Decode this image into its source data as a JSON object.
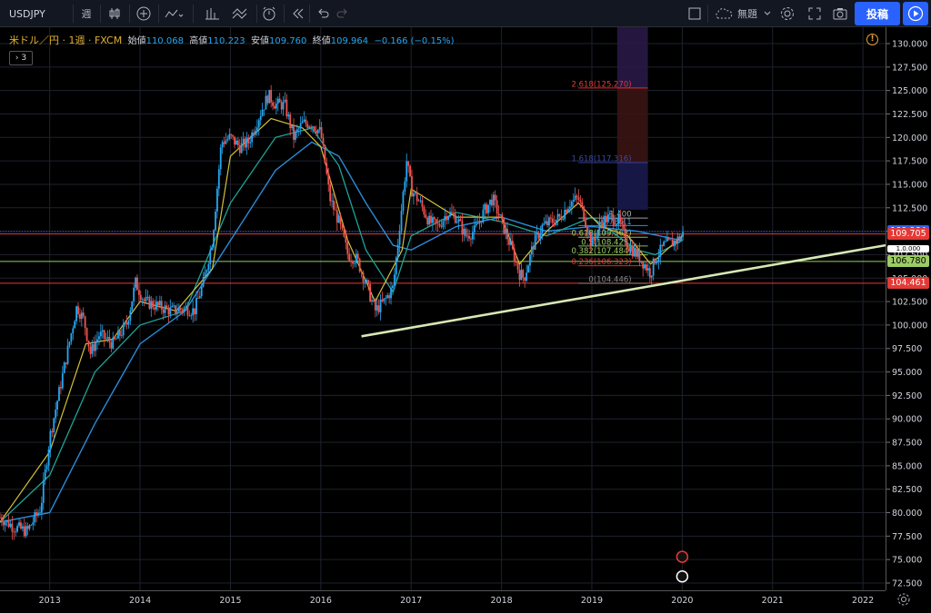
{
  "toolbar": {
    "symbol": "USDJPY",
    "interval": "週",
    "layout_name": "無題",
    "publish_label": "投稿",
    "icons": [
      "candles-icon",
      "add-indicator-icon",
      "compare-icon",
      "indicators-icon",
      "templates-icon",
      "alert-icon",
      "replay-icon",
      "undo-icon",
      "redo-icon",
      "fullscreen-icon",
      "cloud-save-icon",
      "settings-icon",
      "maximize-icon",
      "snapshot-icon",
      "play-icon"
    ]
  },
  "legend": {
    "title": "米ドル／円 · 1週 · FXCM",
    "open_label": "始値",
    "open": "110.068",
    "high_label": "高値",
    "high": "110.223",
    "low_label": "安値",
    "low": "109.760",
    "close_label": "終値",
    "close": "109.964",
    "change": "−0.166 (−0.15%)",
    "collapsed_count": "3"
  },
  "price_labels": [
    {
      "text": "109.964",
      "value": 109.964,
      "color": "#2962ff"
    },
    {
      "text": "109.705",
      "value": 109.705,
      "color": "#e53935"
    },
    {
      "text": "106.780",
      "value": 106.78,
      "color": "#9ccc65"
    },
    {
      "text": "104.461",
      "value": 104.461,
      "color": "#e53935"
    }
  ],
  "fib": [
    {
      "text": "2.618(125.270)",
      "value": 125.27,
      "color": "#e53935"
    },
    {
      "text": "1.618(117.316)",
      "value": 117.316,
      "color": "#3949ab"
    },
    {
      "text": "1.400",
      "value": 111.4,
      "color": "#b0b0b0"
    },
    {
      "text": "0.786(1",
      "value": 110.6,
      "color": "#26a6f0"
    },
    {
      "text": "0.618(109.362)",
      "value": 109.362,
      "color": "#9ccc65"
    },
    {
      "text": "0.5(108.423)",
      "value": 108.423,
      "color": "#9ccc65"
    },
    {
      "text": "0.382(107.484)",
      "value": 107.484,
      "color": "#9ccc65"
    },
    {
      "text": "0.236(106.323)",
      "value": 106.323,
      "color": "#e53935"
    },
    {
      "text": "0(104.446)",
      "value": 104.446,
      "color": "#888888"
    }
  ],
  "overflow_label": "1.0.000",
  "chart_data": {
    "type": "line",
    "yticks": [
      "130.000",
      "127.500",
      "125.000",
      "122.500",
      "120.000",
      "117.500",
      "115.000",
      "112.500",
      "110.000",
      "107.500",
      "105.000",
      "102.500",
      "100.000",
      "97.500",
      "95.000",
      "92.500",
      "90.000",
      "87.500",
      "85.000",
      "82.500",
      "80.000",
      "77.500",
      "75.000",
      "72.500"
    ],
    "ylim": [
      72.5,
      130
    ],
    "xticks": [
      "2013",
      "2014",
      "2015",
      "2016",
      "2017",
      "2018",
      "2019",
      "2020",
      "2021",
      "2022"
    ],
    "xlim": [
      2012.45,
      2022.25
    ],
    "price": {
      "x": [
        2012.45,
        2012.6,
        2012.75,
        2012.9,
        2013.0,
        2013.15,
        2013.3,
        2013.38,
        2013.45,
        2013.55,
        2013.7,
        2013.85,
        2013.95,
        2014.05,
        2014.2,
        2014.35,
        2014.5,
        2014.6,
        2014.7,
        2014.8,
        2014.9,
        2015.0,
        2015.1,
        2015.2,
        2015.35,
        2015.42,
        2015.5,
        2015.6,
        2015.7,
        2015.8,
        2015.9,
        2016.0,
        2016.1,
        2016.2,
        2016.3,
        2016.4,
        2016.5,
        2016.6,
        2016.7,
        2016.8,
        2016.9,
        2016.95,
        2017.0,
        2017.1,
        2017.2,
        2017.3,
        2017.4,
        2017.5,
        2017.6,
        2017.7,
        2017.8,
        2017.9,
        2018.0,
        2018.1,
        2018.2,
        2018.25,
        2018.35,
        2018.45,
        2018.55,
        2018.65,
        2018.75,
        2018.85,
        2018.92,
        2019.0,
        2019.1,
        2019.2,
        2019.3,
        2019.4,
        2019.5,
        2019.58,
        2019.65,
        2019.7,
        2019.8,
        2019.9,
        2020.0,
        2020.02
      ],
      "y": [
        79.5,
        78.5,
        78.0,
        80.5,
        88.0,
        95.0,
        102.0,
        100.5,
        97.0,
        99.0,
        98.0,
        100.0,
        104.5,
        102.5,
        102.0,
        101.5,
        101.8,
        101.5,
        104.5,
        109.0,
        119.5,
        120.0,
        119.0,
        119.5,
        123.0,
        124.5,
        123.5,
        123.5,
        120.0,
        121.5,
        121.5,
        120.5,
        113.5,
        111.0,
        107.5,
        107.0,
        104.5,
        101.5,
        102.5,
        104.0,
        113.0,
        117.5,
        114.5,
        113.0,
        111.0,
        110.5,
        112.0,
        111.5,
        109.5,
        110.0,
        112.0,
        113.5,
        111.0,
        108.5,
        105.5,
        105.0,
        108.5,
        110.5,
        111.0,
        111.5,
        113.0,
        113.5,
        111.5,
        108.5,
        111.0,
        111.5,
        111.0,
        108.5,
        107.5,
        106.5,
        105.5,
        107.0,
        108.5,
        108.8,
        109.5,
        110.0
      ]
    },
    "ma_slow": {
      "x": [
        2012.45,
        2013.0,
        2013.5,
        2014.0,
        2014.5,
        2015.0,
        2015.5,
        2015.9,
        2016.2,
        2016.5,
        2016.8,
        2017.0,
        2017.5,
        2018.0,
        2018.5,
        2019.0,
        2019.5,
        2020.0
      ],
      "y": [
        79.0,
        80.0,
        89.5,
        98.0,
        101.5,
        109.0,
        116.5,
        119.5,
        118.0,
        113.0,
        108.5,
        108.0,
        110.5,
        111.5,
        110.0,
        110.5,
        110.0,
        109.0
      ]
    },
    "ma_mid": {
      "x": [
        2012.45,
        2013.0,
        2013.5,
        2014.0,
        2014.5,
        2015.0,
        2015.5,
        2015.9,
        2016.2,
        2016.5,
        2016.8,
        2017.0,
        2017.5,
        2018.0,
        2018.5,
        2019.0,
        2019.5,
        2019.7,
        2020.0
      ],
      "y": [
        79.0,
        84.0,
        95.0,
        100.0,
        101.5,
        113.0,
        120.0,
        121.0,
        117.0,
        108.0,
        103.5,
        109.5,
        112.0,
        111.0,
        109.5,
        111.5,
        108.0,
        107.5,
        109.0
      ]
    },
    "ma_fast": {
      "x": [
        2012.45,
        2013.0,
        2013.4,
        2013.7,
        2014.0,
        2014.4,
        2014.8,
        2015.0,
        2015.45,
        2015.8,
        2016.0,
        2016.3,
        2016.6,
        2016.9,
        2017.0,
        2017.5,
        2018.0,
        2018.2,
        2018.5,
        2018.85,
        2019.1,
        2019.4,
        2019.65,
        2020.0
      ],
      "y": [
        79.0,
        86.5,
        98.0,
        98.5,
        102.5,
        101.5,
        106.0,
        118.0,
        122.0,
        121.0,
        119.0,
        109.0,
        102.5,
        108.0,
        114.5,
        111.5,
        111.5,
        106.5,
        110.0,
        113.0,
        110.5,
        109.5,
        106.5,
        109.5
      ]
    },
    "trendline": {
      "x": [
        2016.45,
        2022.25
      ],
      "y": [
        98.8,
        108.5
      ]
    }
  }
}
